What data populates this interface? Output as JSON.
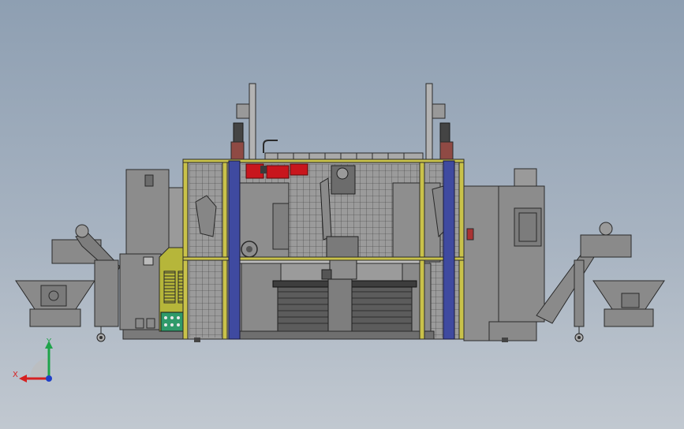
{
  "view": {
    "background_top": "#8e9fb2",
    "background_bottom": "#c1c8d0"
  },
  "triad": {
    "y_label": "Y",
    "x_label": "X",
    "y_color": "#1fa34a",
    "x_color": "#d62020",
    "z_color": "#1f3fc8"
  },
  "colors": {
    "machine_gray": "#8a8a8a",
    "frame_yellow": "#c9c24a",
    "post_blue": "#3f4aa0",
    "gripper_red": "#c8161d",
    "control_green": "#2f9a6a",
    "panel_olive": "#b6b63a"
  }
}
